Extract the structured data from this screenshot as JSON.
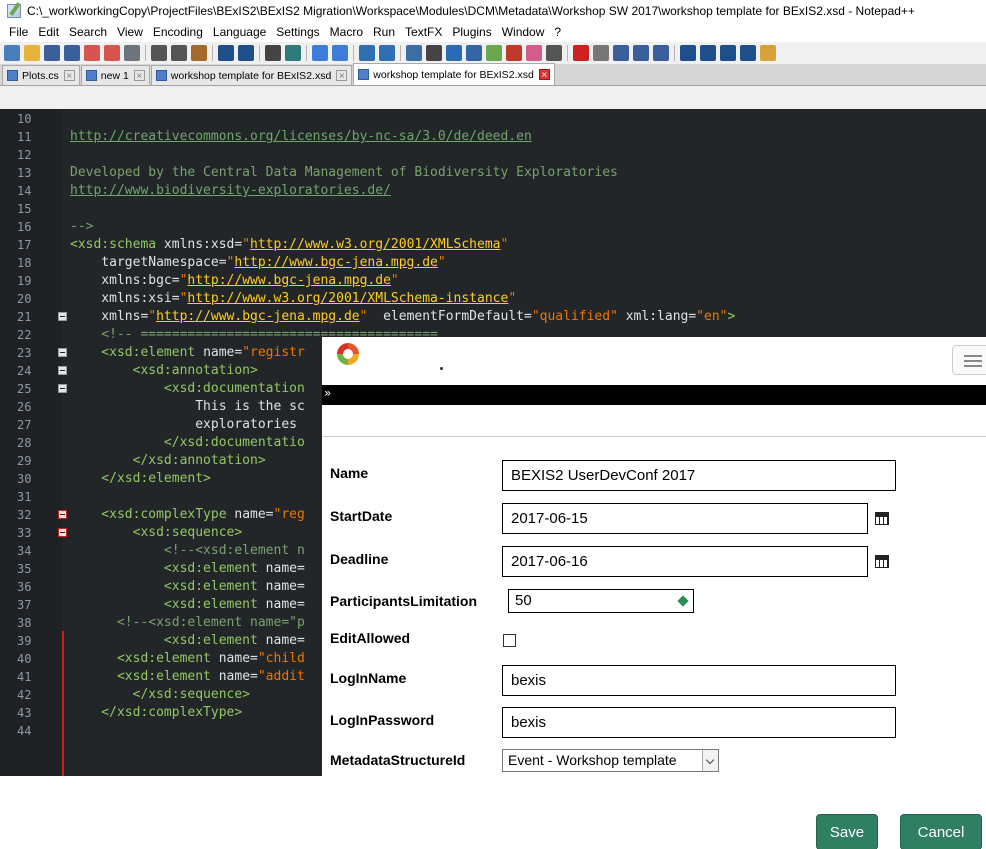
{
  "window": {
    "title": "C:\\_work\\workingCopy\\ProjectFiles\\BExIS2\\BExIS2 Migration\\Workspace\\Modules\\DCM\\Metadata\\Workshop SW 2017\\workshop template for BExIS2.xsd - Notepad++"
  },
  "menu": [
    "File",
    "Edit",
    "Search",
    "View",
    "Encoding",
    "Language",
    "Settings",
    "Macro",
    "Run",
    "TextFX",
    "Plugins",
    "Window",
    "?"
  ],
  "toolbar": [
    {
      "icon": "new-file-icon",
      "color": "#4a7ebb"
    },
    {
      "icon": "open-file-icon",
      "color": "#e8b33b"
    },
    {
      "icon": "save-icon",
      "color": "#3a5f9b"
    },
    {
      "icon": "save-all-icon",
      "color": "#3a5f9b"
    },
    {
      "icon": "close-icon",
      "color": "#d9534f"
    },
    {
      "icon": "close-all-icon",
      "color": "#d9534f"
    },
    {
      "icon": "print-icon",
      "color": "#6c757d"
    },
    {
      "sep": true
    },
    {
      "icon": "cut-icon",
      "color": "#555555"
    },
    {
      "icon": "copy-icon",
      "color": "#555555"
    },
    {
      "icon": "paste-icon",
      "color": "#a36b2b"
    },
    {
      "sep": true
    },
    {
      "icon": "undo-icon",
      "color": "#1f4f8b"
    },
    {
      "icon": "redo-icon",
      "color": "#1f4f8b"
    },
    {
      "sep": true
    },
    {
      "icon": "find-icon",
      "color": "#444444"
    },
    {
      "icon": "replace-icon",
      "color": "#2c7a7b"
    },
    {
      "sep": true
    },
    {
      "icon": "zoom-in-icon",
      "color": "#3b7dd8"
    },
    {
      "icon": "zoom-out-icon",
      "color": "#3b7dd8"
    },
    {
      "sep": true
    },
    {
      "icon": "sync-v-icon",
      "color": "#2d6fb0"
    },
    {
      "icon": "sync-h-icon",
      "color": "#2d6fb0"
    },
    {
      "sep": true
    },
    {
      "icon": "word-wrap-icon",
      "color": "#3c6ea5"
    },
    {
      "icon": "show-all-chars-icon",
      "color": "#444444"
    },
    {
      "icon": "indent-guide-icon",
      "color": "#2a6cb3"
    },
    {
      "icon": "lang-icon",
      "color": "#3465a4"
    },
    {
      "icon": "doc-map-icon",
      "color": "#6aa84f"
    },
    {
      "icon": "function-list-icon",
      "color": "#c0392b"
    },
    {
      "icon": "folder-icon",
      "color": "#d35d8a"
    },
    {
      "icon": "monitor-icon",
      "color": "#555555"
    },
    {
      "sep": true
    },
    {
      "icon": "record-macro-icon",
      "color": "#cc2222"
    },
    {
      "icon": "stop-macro-icon",
      "color": "#777777"
    },
    {
      "icon": "play-macro-icon",
      "color": "#3a5f9b"
    },
    {
      "icon": "run-multiple-icon",
      "color": "#3a5f9b"
    },
    {
      "icon": "save-macro-icon",
      "color": "#3a5f9b"
    },
    {
      "sep": true
    },
    {
      "icon": "first-icon",
      "color": "#1f4f8b"
    },
    {
      "icon": "up-icon",
      "color": "#1f4f8b"
    },
    {
      "icon": "down-icon",
      "color": "#1f4f8b"
    },
    {
      "icon": "last-icon",
      "color": "#1f4f8b"
    },
    {
      "icon": "compare-icon",
      "color": "#d6a33a"
    }
  ],
  "tabs": [
    {
      "label": "Plots.cs",
      "active": false
    },
    {
      "label": "new 1",
      "active": false
    },
    {
      "label": "workshop template for BExIS2.xsd",
      "active": false
    },
    {
      "label": "workshop template for BExIS2.xsd",
      "active": true
    }
  ],
  "editor": {
    "lines": [
      {
        "n": "10",
        "fold": "",
        "parts": []
      },
      {
        "n": "11",
        "fold": "",
        "parts": [
          {
            "t": "link",
            "s": "http://creativecommons.org/licenses/by-nc-sa/3.0/de/deed.en"
          }
        ]
      },
      {
        "n": "12",
        "fold": "",
        "parts": []
      },
      {
        "n": "13",
        "fold": "",
        "parts": [
          {
            "t": "cmt",
            "s": "Developed by the Central Data Management of Biodiversity Exploratories"
          }
        ]
      },
      {
        "n": "14",
        "fold": "",
        "parts": [
          {
            "t": "link",
            "s": "http://www.biodiversity-exploratories.de/"
          }
        ]
      },
      {
        "n": "15",
        "fold": "",
        "parts": []
      },
      {
        "n": "16",
        "fold": "",
        "parts": [
          {
            "t": "cmt",
            "s": "-->"
          }
        ]
      },
      {
        "n": "17",
        "fold": "",
        "parts": [
          {
            "t": "tag",
            "s": "<xsd:schema "
          },
          {
            "t": "attr",
            "s": "xmlns:xsd="
          },
          {
            "t": "str",
            "s": "\""
          },
          {
            "t": "url",
            "s": "http://www.w3.org/2001/XMLSchema"
          },
          {
            "t": "str",
            "s": "\""
          }
        ]
      },
      {
        "n": "18",
        "fold": "",
        "parts": [
          {
            "t": "attr",
            "s": "    targetNamespace="
          },
          {
            "t": "str",
            "s": "\""
          },
          {
            "t": "url",
            "s": "http://www.bgc-jena.mpg.de"
          },
          {
            "t": "str",
            "s": "\""
          }
        ]
      },
      {
        "n": "19",
        "fold": "",
        "parts": [
          {
            "t": "attr",
            "s": "    xmlns:bgc="
          },
          {
            "t": "str",
            "s": "\""
          },
          {
            "t": "url",
            "s": "http://www.bgc-jena.mpg.de"
          },
          {
            "t": "str",
            "s": "\""
          }
        ]
      },
      {
        "n": "20",
        "fold": "",
        "parts": [
          {
            "t": "attr",
            "s": "    xmlns:xsi="
          },
          {
            "t": "str",
            "s": "\""
          },
          {
            "t": "url",
            "s": "http://www.w3.org/2001/XMLSchema-instance"
          },
          {
            "t": "str",
            "s": "\""
          }
        ]
      },
      {
        "n": "21",
        "fold": "box",
        "parts": [
          {
            "t": "attr",
            "s": "    xmlns="
          },
          {
            "t": "str",
            "s": "\""
          },
          {
            "t": "url",
            "s": "http://www.bgc-jena.mpg.de"
          },
          {
            "t": "str",
            "s": "\""
          },
          {
            "t": "attr",
            "s": "  elementFormDefault="
          },
          {
            "t": "str",
            "s": "\"qualified\""
          },
          {
            "t": "attr",
            "s": " xml:lang="
          },
          {
            "t": "str",
            "s": "\"en\""
          },
          {
            "t": "tag",
            "s": ">"
          }
        ]
      },
      {
        "n": "22",
        "fold": "",
        "parts": [
          {
            "t": "cmt",
            "s": "    <!-- ======================================"
          }
        ]
      },
      {
        "n": "23",
        "fold": "box",
        "parts": [
          {
            "t": "tag",
            "s": "    <xsd:element "
          },
          {
            "t": "attr",
            "s": "name="
          },
          {
            "t": "str",
            "s": "\"registr"
          }
        ]
      },
      {
        "n": "24",
        "fold": "box",
        "parts": [
          {
            "t": "tag",
            "s": "        <xsd:annotation>"
          }
        ]
      },
      {
        "n": "25",
        "fold": "box",
        "parts": [
          {
            "t": "tag",
            "s": "            <xsd:documentation"
          }
        ]
      },
      {
        "n": "26",
        "fold": "",
        "parts": [
          {
            "t": "text",
            "s": "                This is the sc"
          }
        ]
      },
      {
        "n": "27",
        "fold": "",
        "parts": [
          {
            "t": "text",
            "s": "                exploratories"
          }
        ]
      },
      {
        "n": "28",
        "fold": "",
        "parts": [
          {
            "t": "tag",
            "s": "            </xsd:documentatio"
          }
        ]
      },
      {
        "n": "29",
        "fold": "",
        "parts": [
          {
            "t": "tag",
            "s": "        </xsd:annotation>"
          }
        ]
      },
      {
        "n": "30",
        "fold": "",
        "parts": [
          {
            "t": "tag",
            "s": "    </xsd:element>"
          }
        ]
      },
      {
        "n": "31",
        "fold": "",
        "parts": []
      },
      {
        "n": "32",
        "fold": "red",
        "parts": [
          {
            "t": "tag",
            "s": "    <xsd:complexType "
          },
          {
            "t": "attr",
            "s": "name="
          },
          {
            "t": "str",
            "s": "\"reg"
          }
        ]
      },
      {
        "n": "33",
        "fold": "red",
        "parts": [
          {
            "t": "tag",
            "s": "        <xsd:sequence>"
          }
        ]
      },
      {
        "n": "34",
        "fold": "",
        "parts": [
          {
            "t": "cmt",
            "s": "            <!--<xsd:element n"
          }
        ]
      },
      {
        "n": "35",
        "fold": "",
        "parts": [
          {
            "t": "tag",
            "s": "            <xsd:element "
          },
          {
            "t": "attr",
            "s": "name="
          }
        ]
      },
      {
        "n": "36",
        "fold": "",
        "parts": [
          {
            "t": "tag",
            "s": "            <xsd:element "
          },
          {
            "t": "attr",
            "s": "name="
          }
        ]
      },
      {
        "n": "37",
        "fold": "",
        "parts": [
          {
            "t": "tag",
            "s": "            <xsd:element "
          },
          {
            "t": "attr",
            "s": "name="
          }
        ]
      },
      {
        "n": "38",
        "fold": "",
        "parts": [
          {
            "t": "cmt",
            "s": "      <!--<xsd:element name=\"p"
          }
        ]
      },
      {
        "n": "39",
        "fold": "",
        "parts": [
          {
            "t": "tag",
            "s": "            <xsd:element "
          },
          {
            "t": "attr",
            "s": "name="
          }
        ]
      },
      {
        "n": "40",
        "fold": "",
        "parts": [
          {
            "t": "tag",
            "s": "      <xsd:element "
          },
          {
            "t": "attr",
            "s": "name="
          },
          {
            "t": "str",
            "s": "\"child"
          }
        ]
      },
      {
        "n": "41",
        "fold": "",
        "parts": [
          {
            "t": "tag",
            "s": "      <xsd:element "
          },
          {
            "t": "attr",
            "s": "name="
          },
          {
            "t": "str",
            "s": "\"addit"
          }
        ]
      },
      {
        "n": "42",
        "fold": "",
        "parts": [
          {
            "t": "tag",
            "s": "        </xsd:sequence>"
          }
        ]
      },
      {
        "n": "43",
        "fold": "",
        "parts": [
          {
            "t": "tag",
            "s": "    </xsd:complexType>"
          }
        ]
      },
      {
        "n": "44",
        "fold": "",
        "parts": []
      }
    ]
  },
  "form": {
    "fields": {
      "name": {
        "label": "Name",
        "value": "BEXIS2 UserDevConf 2017"
      },
      "start_date": {
        "label": "StartDate",
        "value": "2017-06-15"
      },
      "deadline": {
        "label": "Deadline",
        "value": "2017-06-16"
      },
      "participants": {
        "label": "ParticipantsLimitation",
        "value": "50"
      },
      "edit_allowed": {
        "label": "EditAllowed",
        "checked": false
      },
      "login_name": {
        "label": "LogInName",
        "value": "bexis"
      },
      "login_password": {
        "label": "LogInPassword",
        "value": "bexis"
      },
      "metadata_structure": {
        "label": "MetadataStructureId",
        "value": "Event - Workshop template"
      }
    },
    "save_label": "Save",
    "cancel_label": "Cancel"
  }
}
